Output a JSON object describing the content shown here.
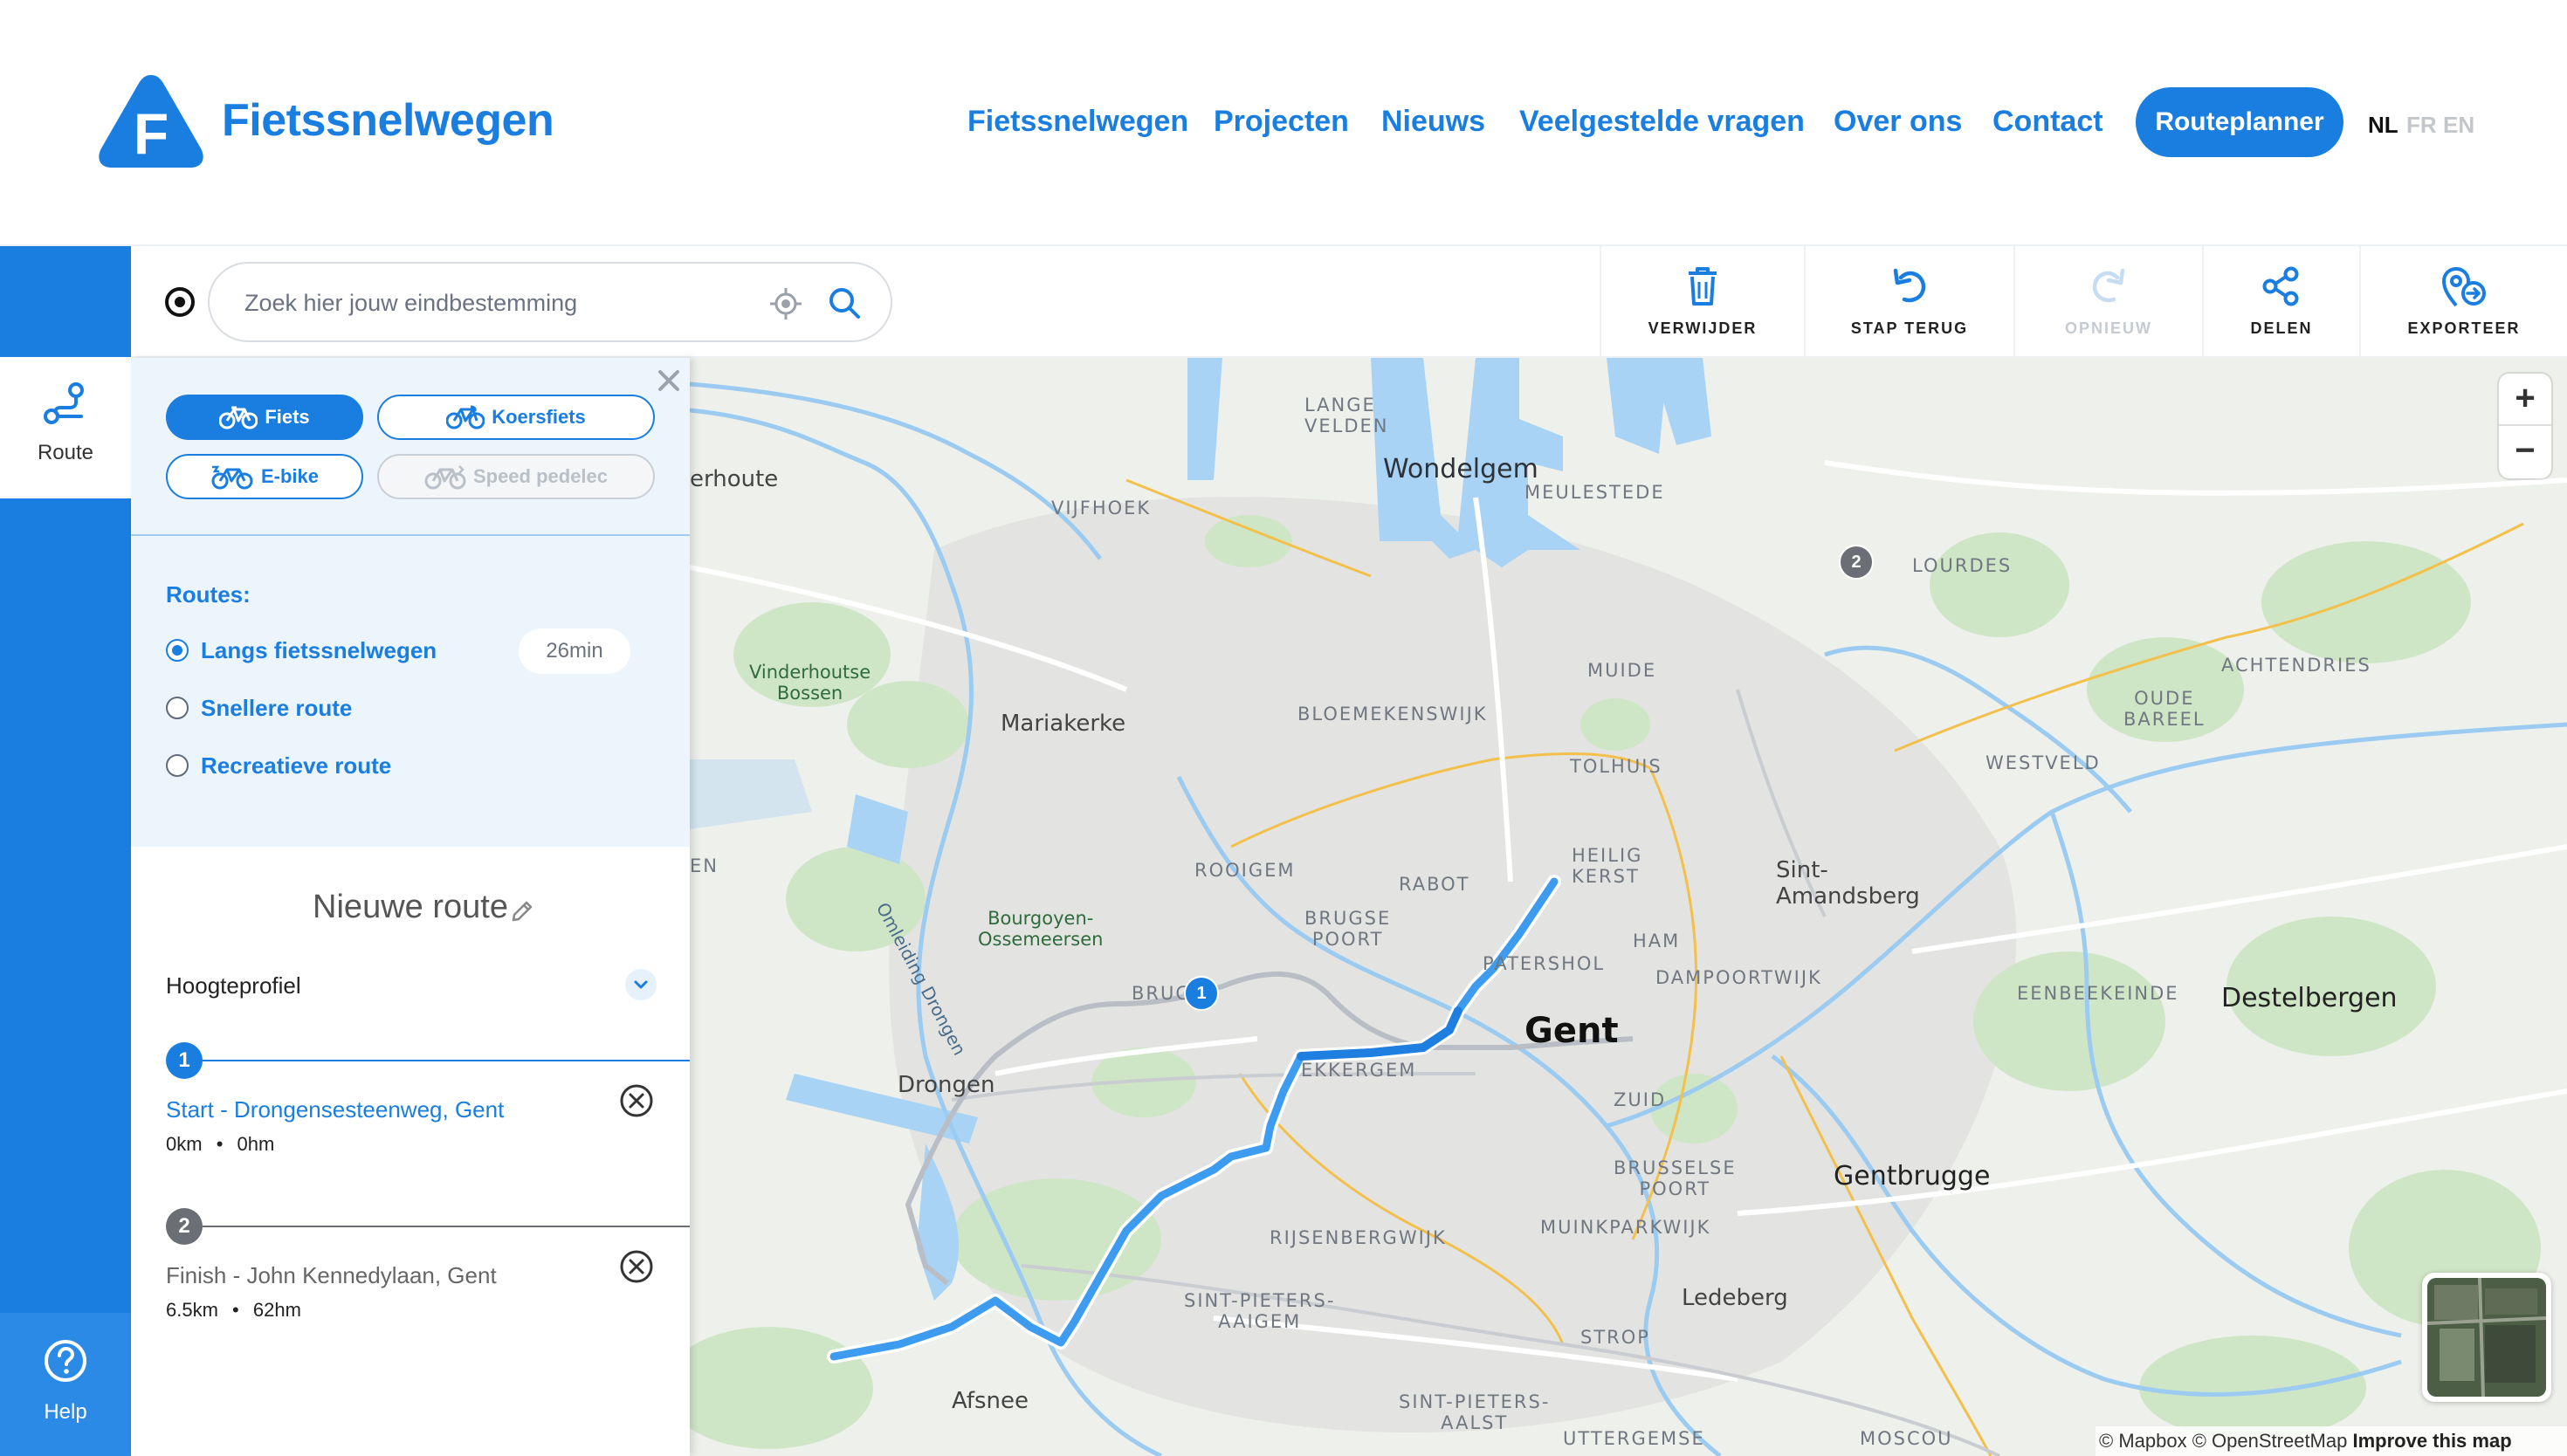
{
  "header": {
    "brand": "Fietssnelwegen",
    "logo_letter": "F",
    "nav": [
      "Fietssnelwegen",
      "Projecten",
      "Nieuws",
      "Veelgestelde vragen",
      "Over ons",
      "Contact"
    ],
    "cta": "Routeplanner",
    "languages": [
      "NL",
      "FR",
      "EN"
    ],
    "active_language": "NL"
  },
  "rail": {
    "route_label": "Route",
    "help_label": "Help"
  },
  "search": {
    "placeholder": "Zoek hier jouw eindbestemming"
  },
  "toolbar": {
    "delete": "VERWIJDER",
    "undo": "STAP TERUG",
    "redo": "OPNIEUW",
    "share": "DELEN",
    "export": "EXPORTEER"
  },
  "panel": {
    "modes": [
      "Fiets",
      "Koersfiets",
      "E-bike",
      "Speed pedelec"
    ],
    "active_mode": "Fiets",
    "routes_heading": "Routes:",
    "route_options": [
      "Langs fietssnelwegen",
      "Snellere route",
      "Recreatieve route"
    ],
    "selected_route": "Langs fietssnelwegen",
    "route_time": "26min",
    "route_title": "Nieuwe route",
    "elevation_label": "Hoogteprofiel",
    "stops": [
      {
        "number": "1",
        "name": "Start - Drongensesteenweg, Gent",
        "distance": "0km",
        "elevation": "0hm"
      },
      {
        "number": "2",
        "name": "Finish - John Kennedylaan, Gent",
        "distance": "6.5km",
        "elevation": "62hm"
      }
    ],
    "meta_separator": "•"
  },
  "map": {
    "labels": {
      "lange_velden": "LANGE\nVELDEN",
      "wondelgem": "Wondelgem",
      "meulestede": "MEULESTEDE",
      "lourdes": "LOURDES",
      "erhoute": "erhoute",
      "vijfhoek": "VIJFHOEK",
      "vinderhoutse_bossen": "Vinderhoutse\nBossen",
      "muide": "MUIDE",
      "achtendries": "ACHTENDRIES",
      "oude_bareel": "OUDE\nBAREEL",
      "mariakerke": "Mariakerke",
      "bloemekenswijk": "BLOEMEKENSWIJK",
      "westveld": "WESTVELD",
      "tolhuis": "TOLHUIS",
      "heilig_kerst": "HEILIG\nKERST",
      "rooigem": "ROOIGEM",
      "rabot": "RABOT",
      "sint_amandsberg": "Sint-\nAmandsberg",
      "en": "EN",
      "bourgoyen": "Bourgoyen-\nOssemeersen",
      "brugse_poort": "BRUGSE\nPOORT",
      "patershol": "PATERSHOL",
      "ham": "HAM",
      "dampoortwijk": "DAMPOORTWIJK",
      "eenbeekeinde": "EENBEEKEINDE",
      "destelbergen": "Destelbergen",
      "brug": "BRUG",
      "gent": "Gent",
      "drongen": "Drongen",
      "ekkergem": "EKKERGEM",
      "zuid": "ZUID",
      "gentbrugge": "Gentbrugge",
      "brusselse_poort": "BRUSSELSE\nPOORT",
      "rijsenbergwijk": "RIJSENBERGWIJK",
      "muinkparkwijk": "MUINKPARKWIJK",
      "sint_pieters_aaigem": "SINT-PIETERS-\nAAIGEM",
      "ledeberg": "Ledeberg",
      "strop": "STROP",
      "afsnee": "Afsnee",
      "sint_pieters_aalst": "SINT-PIETERS-\nAALST",
      "uttergemse": "UTTERGEMSE",
      "moscou": "MOSCOU",
      "drongen_canal": "Omleiding Drongen"
    },
    "marker_start": "1",
    "marker_end": "2",
    "zoom_in": "+",
    "zoom_out": "−",
    "attribution": {
      "mapbox": "© Mapbox",
      "osm": "© OpenStreetMap",
      "improve": "Improve this map"
    }
  },
  "colors": {
    "brand": "#1a7ee0",
    "route": "#3d9bf0",
    "alt_route": "#b5bac2",
    "water": "#a9d3f5",
    "park": "#cde6c4"
  }
}
